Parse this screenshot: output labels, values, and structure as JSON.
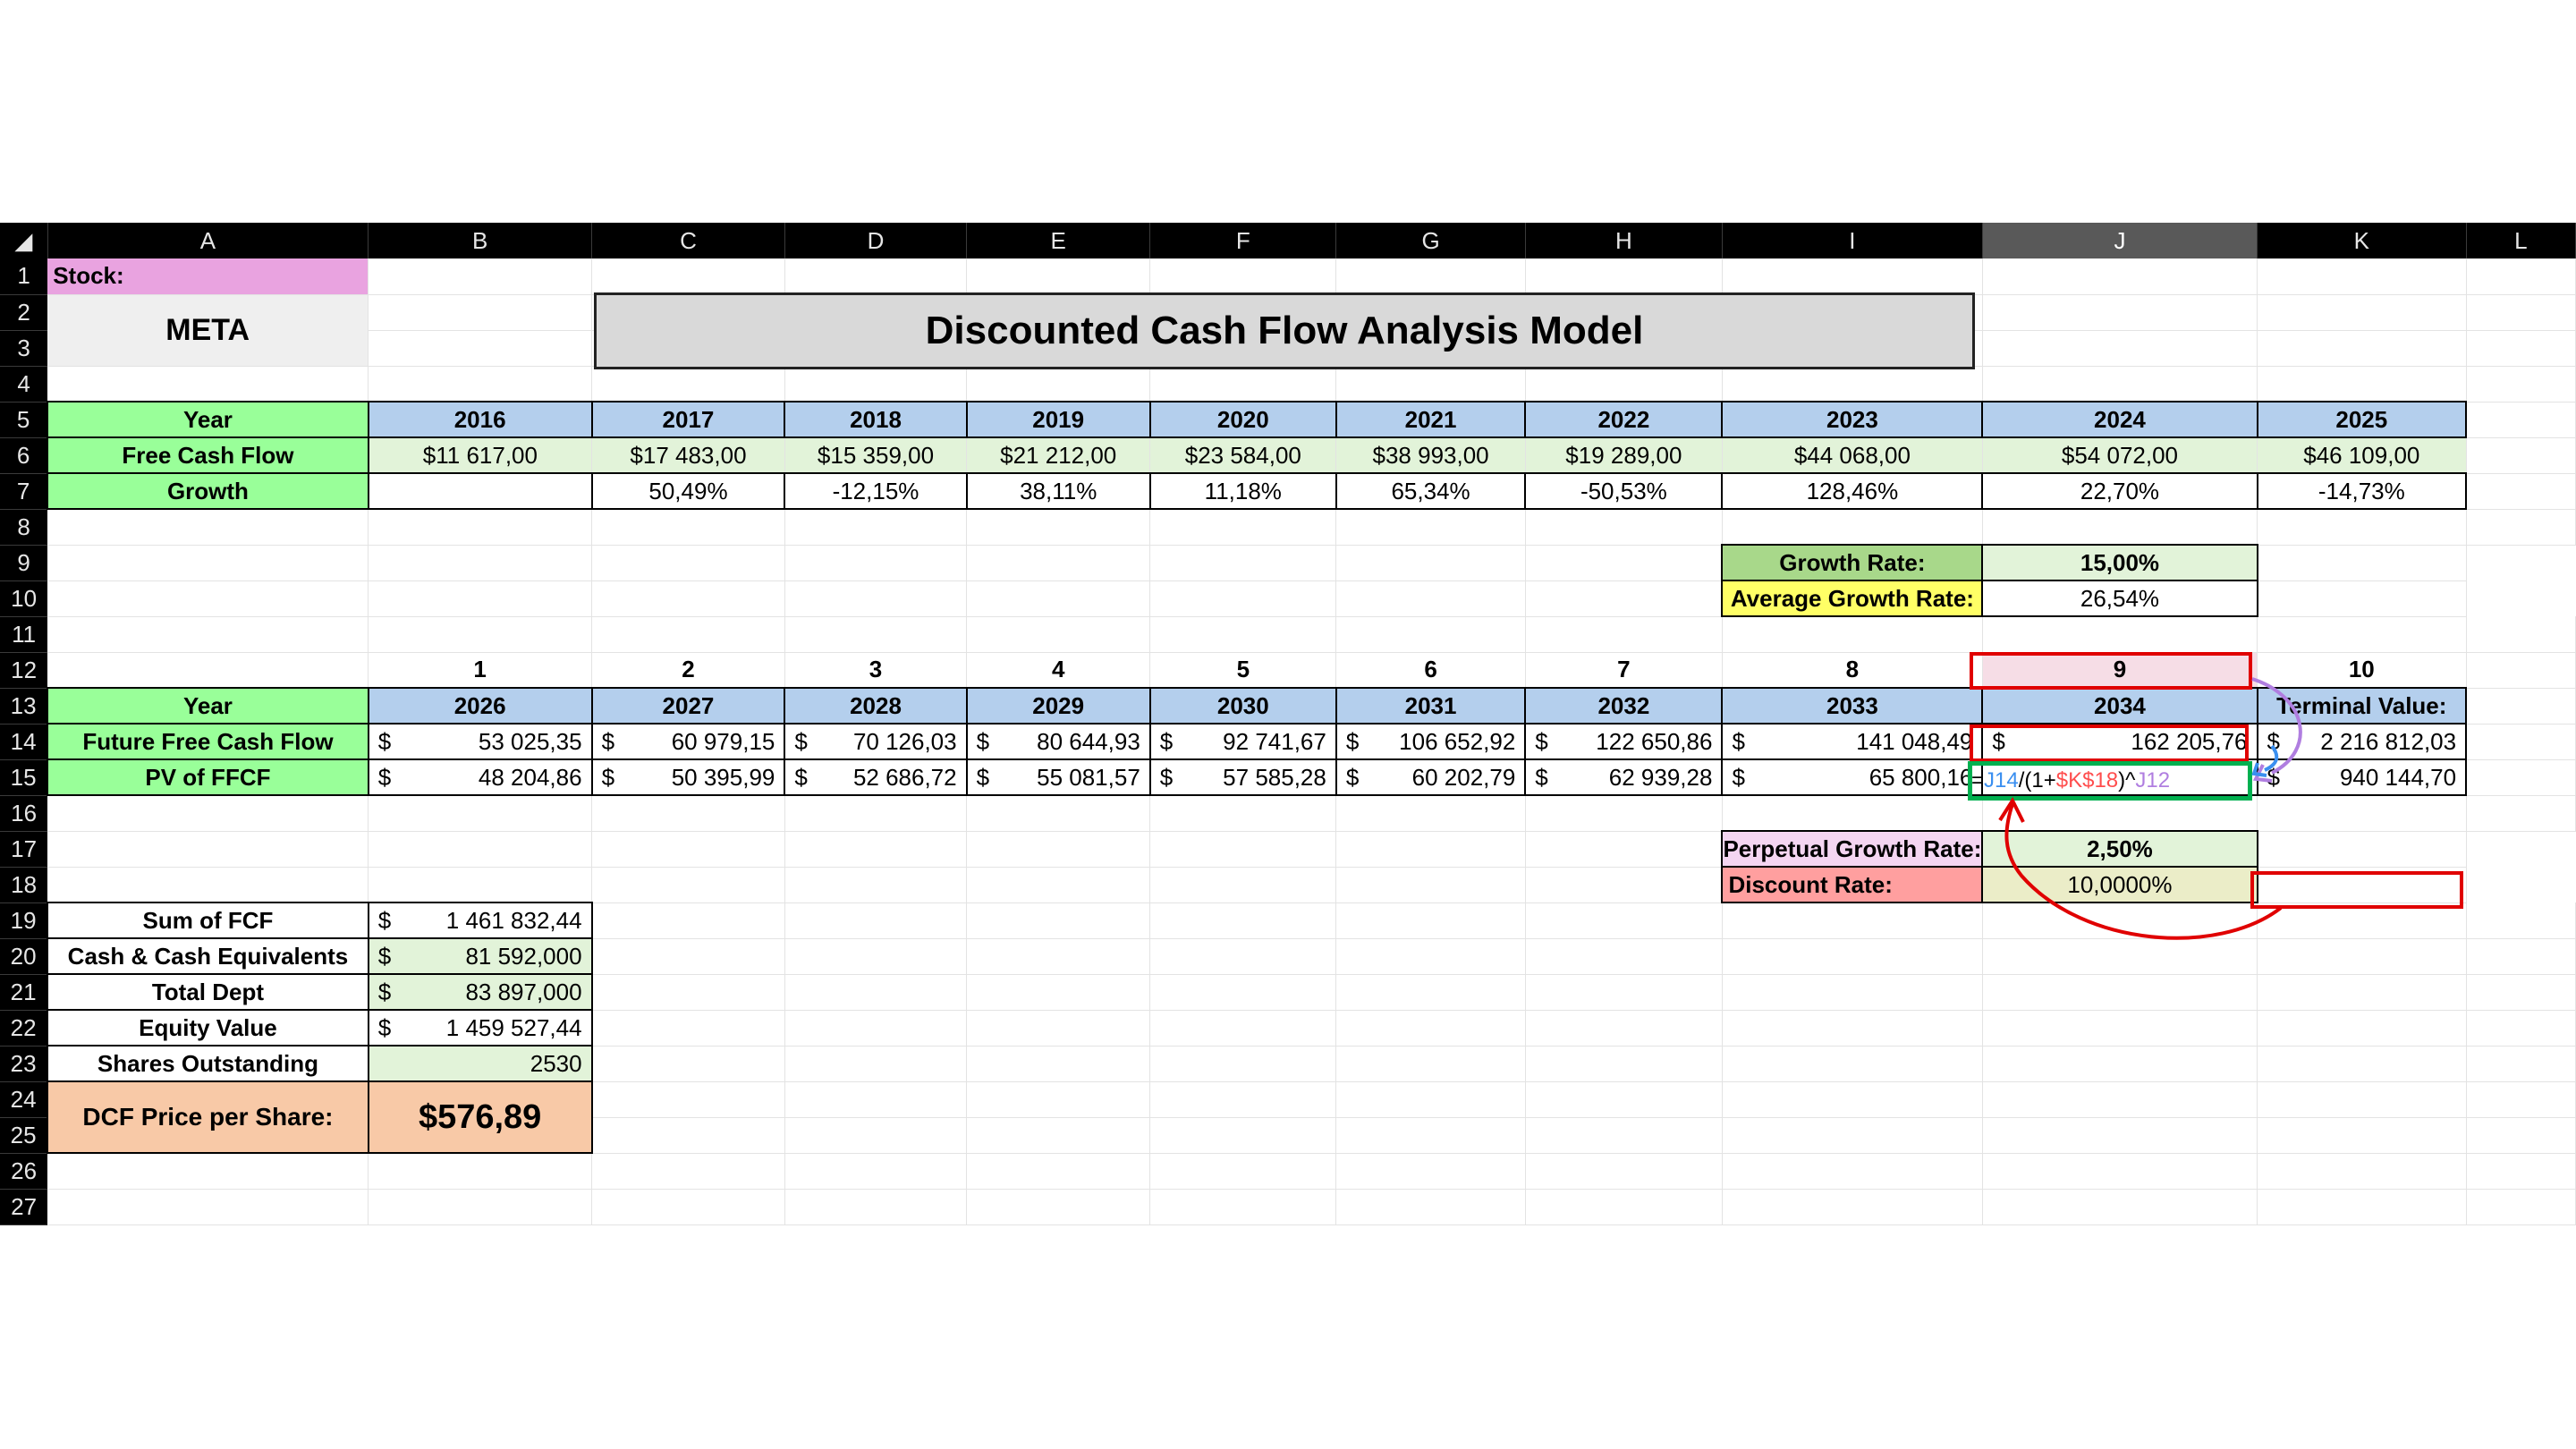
{
  "columns": [
    "A",
    "B",
    "C",
    "D",
    "E",
    "F",
    "G",
    "H",
    "I",
    "J",
    "K",
    "L"
  ],
  "rows": [
    "1",
    "2",
    "3",
    "4",
    "5",
    "6",
    "7",
    "8",
    "9",
    "10",
    "11",
    "12",
    "13",
    "14",
    "15",
    "16",
    "17",
    "18",
    "19",
    "20",
    "21",
    "22",
    "23",
    "24",
    "25",
    "26",
    "27"
  ],
  "selected_column": "J",
  "stock_label": "Stock:",
  "ticker": "META",
  "title": "Discounted Cash Flow Analysis Model",
  "historical": {
    "year_label": "Year",
    "fcf_label": "Free Cash Flow",
    "growth_label": "Growth",
    "years": [
      "2016",
      "2017",
      "2018",
      "2019",
      "2020",
      "2021",
      "2022",
      "2023",
      "2024",
      "2025"
    ],
    "fcf": [
      "$11 617,00",
      "$17 483,00",
      "$15 359,00",
      "$21 212,00",
      "$23 584,00",
      "$38 993,00",
      "$19 289,00",
      "$44 068,00",
      "$54 072,00",
      "$46 109,00"
    ],
    "growth": [
      "",
      "50,49%",
      "-12,15%",
      "38,11%",
      "11,18%",
      "65,34%",
      "-50,53%",
      "128,46%",
      "22,70%",
      "-14,73%"
    ]
  },
  "rates": {
    "growth_rate_label": "Growth Rate:",
    "growth_rate": "15,00%",
    "avg_growth_label": "Average Growth Rate:",
    "avg_growth": "26,54%",
    "perpetual_label": "Perpetual Growth Rate:",
    "perpetual": "2,50%",
    "discount_label": "Discount Rate:",
    "discount": "10,0000%"
  },
  "projection": {
    "periods": [
      "1",
      "2",
      "3",
      "4",
      "5",
      "6",
      "7",
      "8",
      "9",
      "10"
    ],
    "year_label": "Year",
    "years": [
      "2026",
      "2027",
      "2028",
      "2029",
      "2030",
      "2031",
      "2032",
      "2033",
      "2034"
    ],
    "terminal_label": "Terminal Value:",
    "ffcf_label": "Future Free Cash Flow",
    "pv_label": "PV of FFCF",
    "currency": "$",
    "ffcf": [
      "53 025,35",
      "60 979,15",
      "70 126,03",
      "80 644,93",
      "92 741,67",
      "106 652,92",
      "122 650,86",
      "141 048,49",
      "162 205,76",
      "2 216 812,03"
    ],
    "pv": [
      "48 204,86",
      "50 395,99",
      "52 686,72",
      "55 081,57",
      "57 585,28",
      "60 202,79",
      "62 939,28",
      "65 800,16",
      "",
      "940 144,70"
    ]
  },
  "formula": {
    "eq": "=",
    "ref1": "J14",
    "mid": "/(1+",
    "ref2": "$K$18",
    "pow": ")^",
    "ref3": "J12"
  },
  "summary": {
    "currency": "$",
    "sum_fcf_label": "Sum of FCF",
    "sum_fcf": "1 461 832,44",
    "cash_label": "Cash & Cash Equivalents",
    "cash": "81 592,000",
    "debt_label": "Total Dept",
    "debt": "83 897,000",
    "equity_label": "Equity Value",
    "equity": "1 459 527,44",
    "shares_label": "Shares Outstanding",
    "shares": "2530",
    "price_label": "DCF Price per Share:",
    "price": "$576,89"
  },
  "colors": {
    "header_bg": "#000000",
    "green": "#99ff99",
    "blue": "#b4cfed",
    "light_green": "#e2f3d9",
    "annotation_red": "#e00000",
    "annotation_green": "#00b050",
    "annotation_purple": "#b07ee0",
    "annotation_blue": "#3a8ff0"
  }
}
